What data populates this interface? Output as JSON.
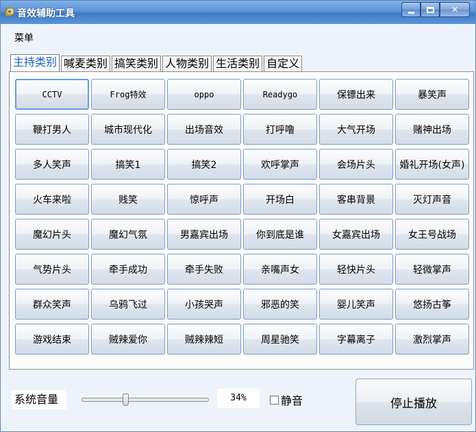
{
  "window": {
    "title": "音效辅助工具"
  },
  "menu": {
    "items": [
      "菜单"
    ]
  },
  "tabs": [
    "主持类别",
    "喊麦类别",
    "搞笑类别",
    "人物类别",
    "生活类别",
    "自定义"
  ],
  "active_tab": 0,
  "sound_buttons": [
    "CCTV",
    "Frog特效",
    "oppo",
    "Readygo",
    "保镖出来",
    "暴笑声",
    "鞭打男人",
    "城市现代化",
    "出场音效",
    "打呼噜",
    "大气开场",
    "赌神出场",
    "多人笑声",
    "搞笑1",
    "搞笑2",
    "欢呼掌声",
    "会场片头",
    "婚礼开场(女声)",
    "火车来啦",
    "贱笑",
    "惊呼声",
    "开场白",
    "客串背景",
    "灭灯声音",
    "魔幻片头",
    "魔幻气氛",
    "男嘉宾出场",
    "你到底是谁",
    "女嘉宾出场",
    "女王号战场",
    "气势片头",
    "牵手成功",
    "牵手失败",
    "亲嘴声女",
    "轻快片头",
    "轻微掌声",
    "群众笑声",
    "乌鸦飞过",
    "小孩哭声",
    "邪恶的笑",
    "婴儿笑声",
    "悠扬古筝",
    "游戏结束",
    "贼辣爱你",
    "贼辣辣短",
    "周星驰笑",
    "字幕离子",
    "激烈掌声"
  ],
  "volume": {
    "label": "系统音量",
    "value_text": "34%",
    "value": 0.34
  },
  "mute": {
    "label": "静音",
    "checked": false
  },
  "stop_button": {
    "label": "停止播放"
  },
  "colors": {
    "titlebar": "#4f86cc",
    "active_tab_text": "#1a5fd0",
    "window_bg": "#eef3fb"
  }
}
